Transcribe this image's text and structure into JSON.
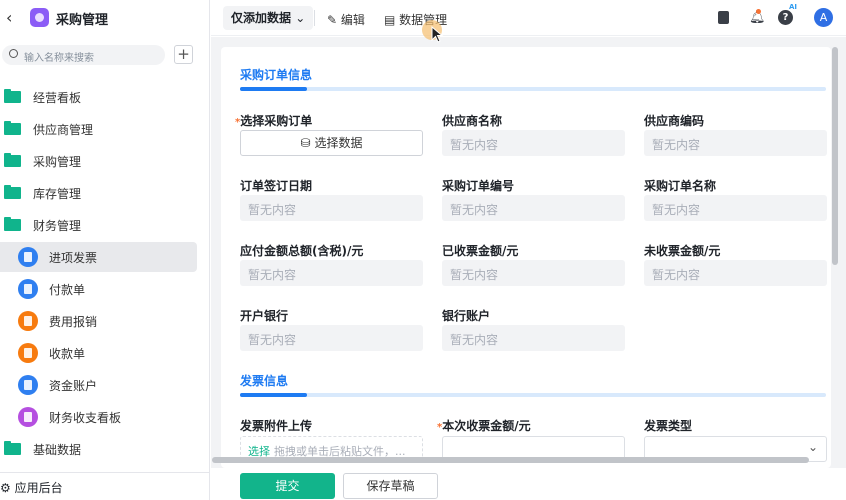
{
  "app": {
    "title": "采购管理",
    "back_icon": "chevron-left-icon"
  },
  "sidebar": {
    "search_placeholder": "输入名称来搜索",
    "add_label": "+",
    "groups": [
      {
        "label": "经营看板",
        "icon": "folder-icon"
      },
      {
        "label": "供应商管理",
        "icon": "folder-icon"
      },
      {
        "label": "采购管理",
        "icon": "folder-icon"
      },
      {
        "label": "库存管理",
        "icon": "folder-icon"
      },
      {
        "label": "财务管理",
        "icon": "folder-icon"
      }
    ],
    "children": [
      {
        "label": "进项发票",
        "icon": "document-icon",
        "color": "#2f7ff0",
        "selected": true
      },
      {
        "label": "付款单",
        "icon": "document-icon",
        "color": "#2f7ff0"
      },
      {
        "label": "费用报销",
        "icon": "wallet-icon",
        "color": "#f77b0f"
      },
      {
        "label": "收款单",
        "icon": "clipboard-icon",
        "color": "#f77b0f"
      },
      {
        "label": "资金账户",
        "icon": "document-icon",
        "color": "#2f7ff0"
      },
      {
        "label": "财务收支看板",
        "icon": "dashboard-icon",
        "color": "#b54fe0"
      }
    ],
    "last_group": {
      "label": "基础数据",
      "icon": "folder-icon"
    },
    "backend": {
      "label": "应用后台",
      "icon": "gear-icon"
    }
  },
  "toolbar": {
    "mode": "仅添加数据",
    "edit": "编辑",
    "data_manage": "数据管理",
    "ai_badge": "AI",
    "avatar": "A"
  },
  "form": {
    "section1": "采购订单信息",
    "section2": "发票信息",
    "empty": "暂无内容",
    "select_order_label": "选择采购订单",
    "select_data_button": "选择数据",
    "fields": [
      [
        "供应商名称",
        "供应商编码"
      ],
      [
        "订单签订日期",
        "采购订单编号",
        "采购订单名称"
      ],
      [
        "应付金额总额(含税)/元",
        "已收票金额/元",
        "未收票金额/元"
      ],
      [
        "开户银行",
        "银行账户"
      ]
    ],
    "invoice_attach_label": "发票附件上传",
    "upload_select": "选择",
    "upload_hint": "拖拽或单击后粘贴文件，...",
    "invoice_amount_label": "本次收票金额/元",
    "invoice_type_label": "发票类型"
  },
  "footer": {
    "submit": "提交",
    "draft": "保存草稿"
  },
  "colors": {
    "accent": "#1e7bf2",
    "primary_button": "#12b48b",
    "folder": "#10b48c"
  }
}
